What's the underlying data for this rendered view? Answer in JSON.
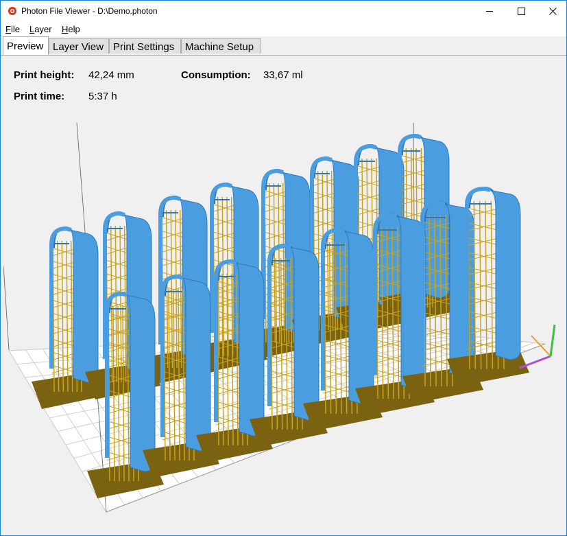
{
  "window": {
    "title": "Photon File Viewer - D:\\Demo.photon"
  },
  "menu": {
    "items": [
      "File",
      "Layer",
      "Help"
    ]
  },
  "tabs": [
    {
      "label": "Preview",
      "active": true
    },
    {
      "label": "Layer View",
      "active": false
    },
    {
      "label": "Print Settings",
      "active": false
    },
    {
      "label": "Machine Setup",
      "active": false
    }
  ],
  "info": {
    "print_height_label": "Print height:",
    "print_height_value": "42,24 mm",
    "consumption_label": "Consumption:",
    "consumption_value": "33,67 ml",
    "print_time_label": "Print time:",
    "print_time_value": "5:37 h"
  },
  "colors": {
    "part": "#4a9ee0",
    "part_shadow": "#2f77b8",
    "support": "#c8a31f",
    "raft": "#7a6210",
    "grid": "#d0d0d0"
  }
}
